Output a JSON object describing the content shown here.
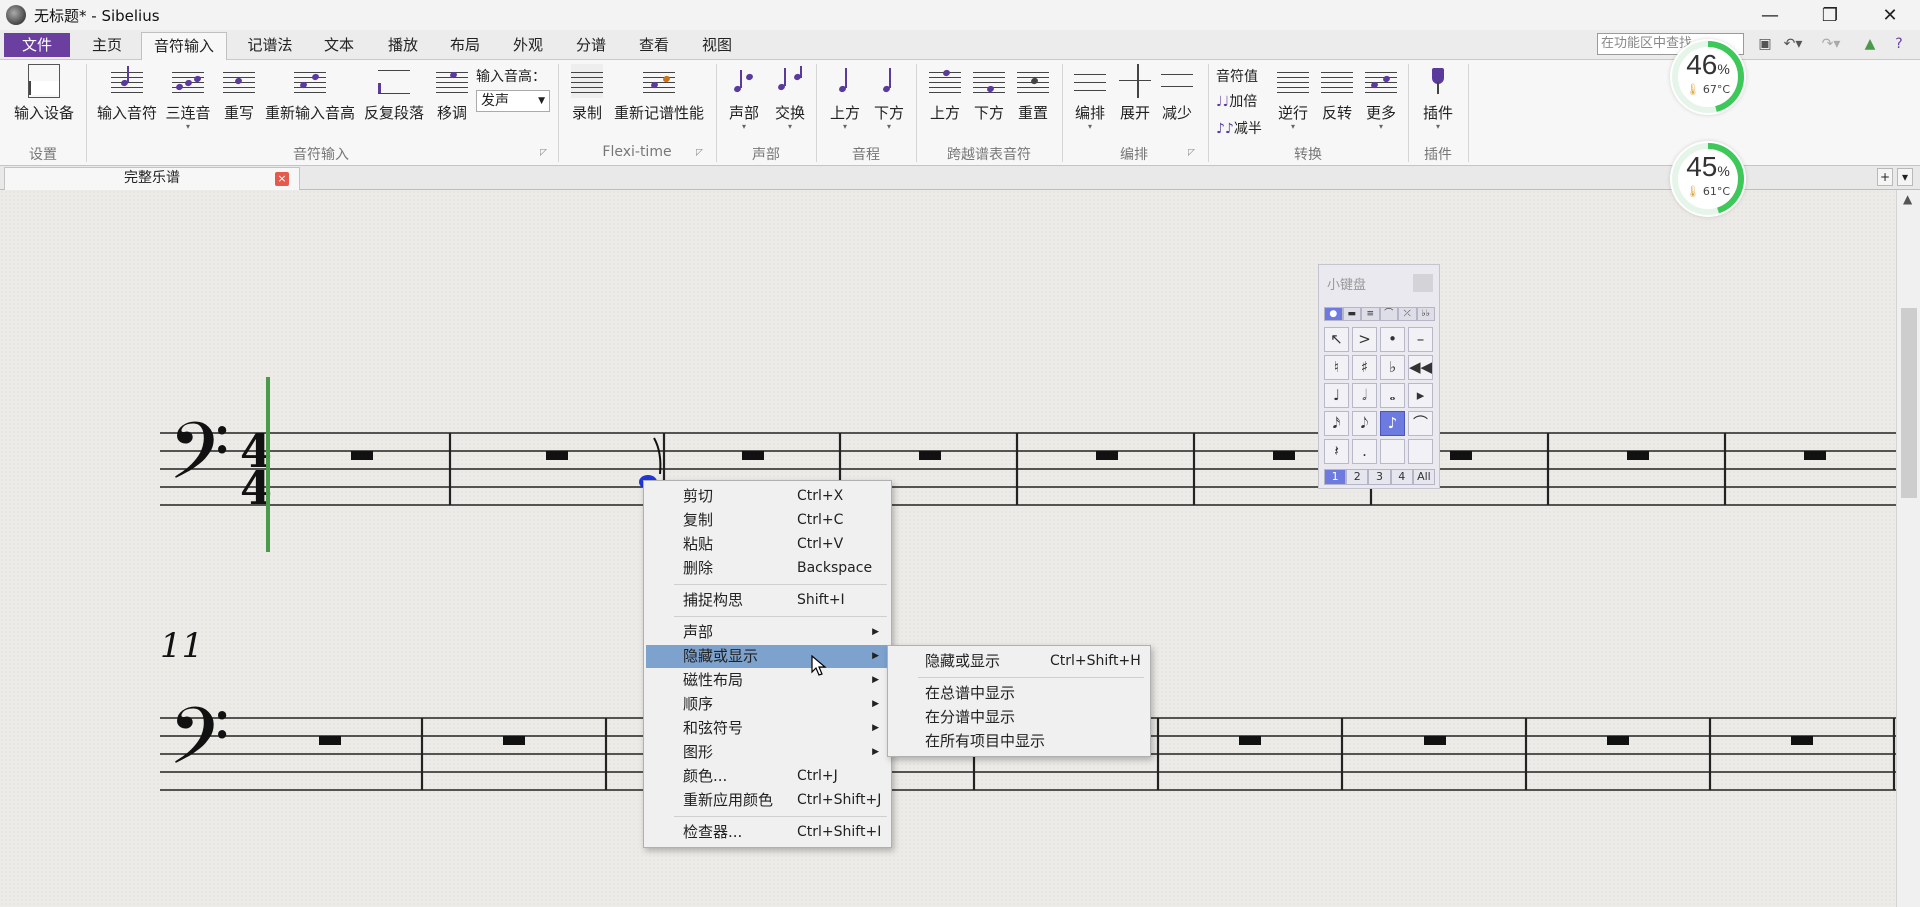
{
  "window": {
    "title": "无标题* - Sibelius",
    "min": "—",
    "restore": "❐",
    "close": "✕"
  },
  "tabs": [
    "文件",
    "主页",
    "音符输入",
    "记谱法",
    "文本",
    "播放",
    "布局",
    "外观",
    "分谱",
    "查看",
    "视图"
  ],
  "active_tab": "音符输入",
  "search": {
    "placeholder": "在功能区中查找"
  },
  "ribbon": {
    "buttons": {
      "input_device": "输入设备",
      "input_notes": "输入音符",
      "triplet": "三连音",
      "rewrite": "重写",
      "reinput_pitch": "重新输入音高",
      "repeat_section": "反复段落",
      "transpose": "移调",
      "input_pitch_label": "输入音高：",
      "input_pitch_value": "发声",
      "record": "录制",
      "renotate": "重新记谱性能",
      "voice": "声部",
      "swap": "交换",
      "interval_up": "上方",
      "interval_down": "下方",
      "cross_up": "上方",
      "cross_down": "下方",
      "cross_reset": "重置",
      "arrange": "编排",
      "explode": "展开",
      "reduce": "减少",
      "note_value": "音符值",
      "double": "加倍",
      "halve": "减半",
      "retrograde": "逆行",
      "invert": "反转",
      "more": "更多",
      "plugins": "插件"
    },
    "groups": {
      "setup": "设置",
      "note_input": "音符输入",
      "flexi_time": "Flexi-time",
      "voice": "声部",
      "interval": "音程",
      "cross_staff": "跨越谱表音符",
      "arrange": "编排",
      "transform": "转换",
      "plugins": "插件"
    }
  },
  "document_tab": {
    "label": "完整乐谱",
    "close": "×"
  },
  "score": {
    "measure_number": "11"
  },
  "keypad": {
    "title": "小键盘",
    "layouts": [
      "1",
      "2",
      "3",
      "4",
      "All"
    ],
    "selected_layout": "1",
    "keys": [
      "↖",
      ">",
      "•",
      "–",
      "♮",
      "♯",
      "♭",
      "◀◀",
      "♩",
      "𝅗𝅥",
      "𝅝",
      "▸",
      "𝅘𝅥𝅯",
      "𝅘𝅥𝅮",
      "♪",
      "⌒",
      "𝄽",
      ".",
      "",
      ""
    ]
  },
  "context_menu": {
    "items": [
      {
        "label": "剪切",
        "shortcut": "Ctrl+X"
      },
      {
        "label": "复制",
        "shortcut": "Ctrl+C"
      },
      {
        "label": "粘贴",
        "shortcut": "Ctrl+V"
      },
      {
        "label": "删除",
        "shortcut": "Backspace"
      },
      {
        "label": "捕捉构思",
        "shortcut": "Shift+I"
      },
      {
        "label": "声部",
        "shortcut": ""
      },
      {
        "label": "隐藏或显示",
        "shortcut": ""
      },
      {
        "label": "磁性布局",
        "shortcut": ""
      },
      {
        "label": "顺序",
        "shortcut": ""
      },
      {
        "label": "和弦符号",
        "shortcut": ""
      },
      {
        "label": "图形",
        "shortcut": ""
      },
      {
        "label": "颜色...",
        "shortcut": "Ctrl+J"
      },
      {
        "label": "重新应用颜色",
        "shortcut": "Ctrl+Shift+J"
      },
      {
        "label": "检查器...",
        "shortcut": "Ctrl+Shift+I"
      }
    ],
    "highlighted": "隐藏或显示"
  },
  "submenu": {
    "items": [
      {
        "label": "隐藏或显示",
        "shortcut": "Ctrl+Shift+H"
      },
      {
        "label": "在总谱中显示",
        "shortcut": ""
      },
      {
        "label": "在分谱中显示",
        "shortcut": ""
      },
      {
        "label": "在所有项目中显示",
        "shortcut": ""
      }
    ]
  },
  "gauges": [
    {
      "percent": "46",
      "unit": "%",
      "temp": "67°C",
      "level": 0.46
    },
    {
      "percent": "45",
      "unit": "%",
      "temp": "61°C",
      "level": 0.45
    }
  ],
  "colors": {
    "accent": "#6b3fa0",
    "highlight": "#7da2ce",
    "keypad_selected": "#6d7ae0",
    "gauge": "#3fc85a",
    "caret": "#4a9a4a"
  }
}
